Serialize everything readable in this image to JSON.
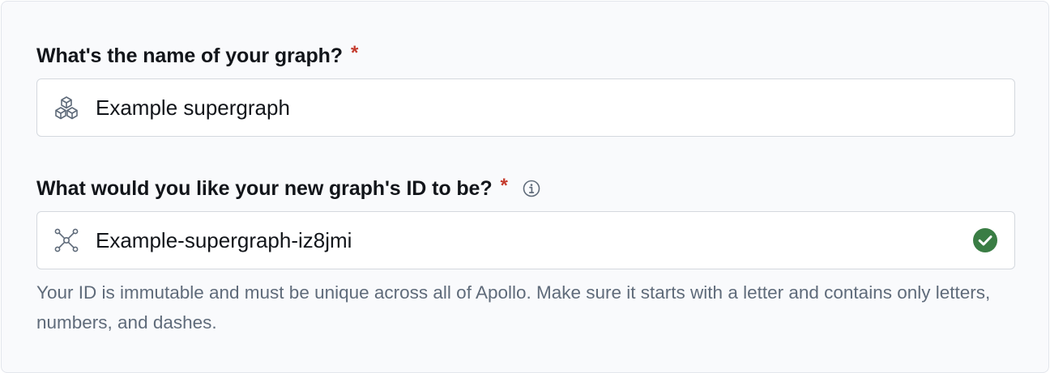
{
  "graph_name": {
    "label": "What's the name of your graph?",
    "required_marker": "*",
    "value": "Example supergraph",
    "icon": "cubes-icon"
  },
  "graph_id": {
    "label": "What would you like your new graph's ID to be?",
    "required_marker": "*",
    "info_icon": "info-icon",
    "value": "Example-supergraph-iz8jmi",
    "icon": "network-icon",
    "status_icon": "check-circle-icon",
    "helper_text": "Your ID is immutable and must be unique across all of Apollo. Make sure it starts with a letter and contains only letters, numbers, and dashes."
  },
  "colors": {
    "required": "#c43a2c",
    "success": "#3a7d44",
    "helper_text": "#5f6b7a",
    "border": "#d4d8de",
    "card_background": "#f9fafc"
  }
}
